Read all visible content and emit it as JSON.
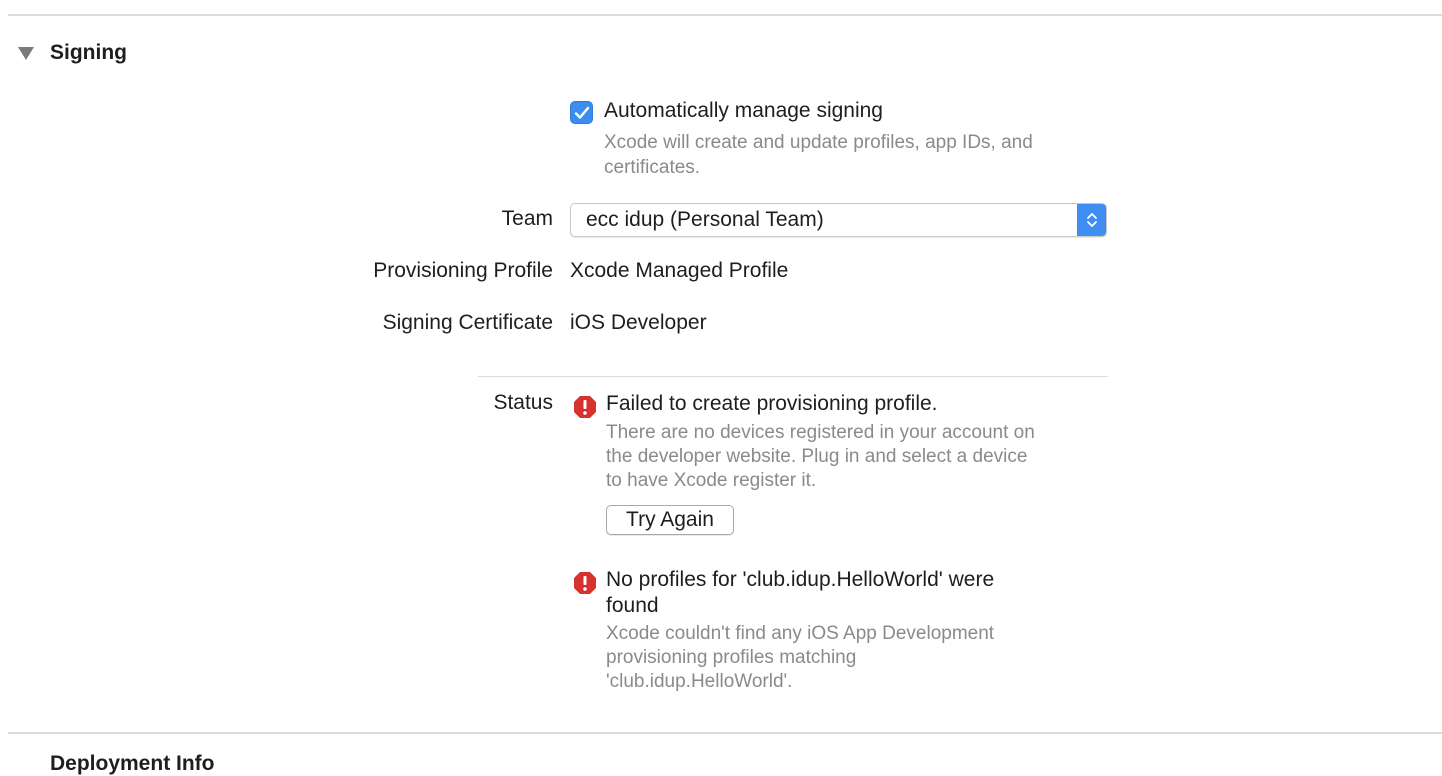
{
  "section": {
    "title": "Signing",
    "disclosure_icon": "disclosure-triangle-down-icon"
  },
  "auto_signing": {
    "checked": true,
    "label": "Automatically manage signing",
    "help_line1": "Xcode will create and update profiles, app IDs, and",
    "help_line2": "certificates."
  },
  "team": {
    "label": "Team",
    "value": "ecc idup (Personal Team)",
    "stepper_icon": "popup-stepper-icon"
  },
  "provisioning_profile": {
    "label": "Provisioning Profile",
    "value": "Xcode Managed Profile"
  },
  "signing_certificate": {
    "label": "Signing Certificate",
    "value": "iOS Developer"
  },
  "status": {
    "label": "Status",
    "errors": [
      {
        "icon": "error-icon",
        "title_line1": "Failed to create provisioning profile.",
        "desc_line1": "There are no devices registered in your account on",
        "desc_line2": "the developer website. Plug in and select a device",
        "desc_line3": "to have Xcode register it.",
        "button_label": "Try Again"
      },
      {
        "icon": "error-icon",
        "title_line1": "No profiles for 'club.idup.HelloWorld' were",
        "title_line2": "found",
        "desc_line1": "Xcode couldn't find any iOS App Development",
        "desc_line2": "provisioning profiles matching",
        "desc_line3": "'club.idup.HelloWorld'."
      }
    ]
  },
  "next_section": {
    "title": "Deployment Info"
  },
  "colors": {
    "accent": "#3b8ef0",
    "error": "#d7332e",
    "secondary_text": "#8a8a8a",
    "divider": "#dcdcdc"
  }
}
